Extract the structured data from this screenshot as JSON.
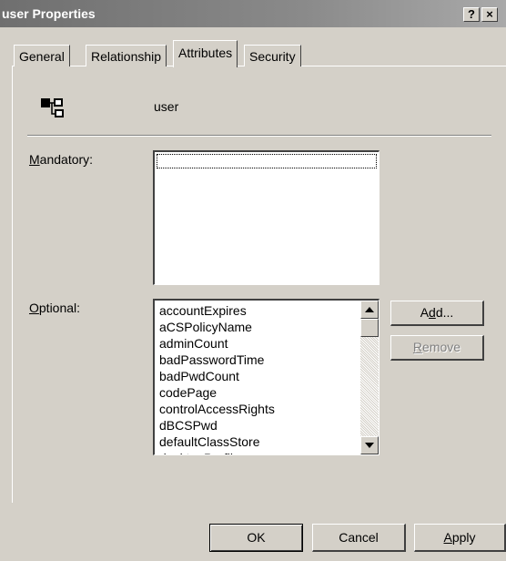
{
  "window": {
    "title": "user Properties",
    "help_label": "?",
    "close_label": "×"
  },
  "tabs": [
    {
      "label": "General",
      "active": false
    },
    {
      "label": "Relationship",
      "active": false
    },
    {
      "label": "Attributes",
      "active": true
    },
    {
      "label": "Security",
      "active": false
    }
  ],
  "class_info": {
    "icon": "class-schema-icon",
    "name": "user"
  },
  "mandatory": {
    "label_mnemonic": "M",
    "label_rest": "andatory:",
    "items": []
  },
  "optional": {
    "label_mnemonic": "O",
    "label_rest": "ptional:",
    "items": [
      "accountExpires",
      "aCSPolicyName",
      "adminCount",
      "badPasswordTime",
      "badPwdCount",
      "codePage",
      "controlAccessRights",
      "dBCSPwd",
      "defaultClassStore",
      "desktopProfile"
    ]
  },
  "buttons": {
    "add_pre": "A",
    "add_mnemonic": "d",
    "add_post": "d...",
    "remove_mnemonic": "R",
    "remove_rest": "emove",
    "ok": "OK",
    "cancel": "Cancel",
    "apply_mnemonic": "A",
    "apply_rest": "pply"
  },
  "colors": {
    "dialog_bg": "#d4d0c8",
    "title_bar": "#808080"
  }
}
